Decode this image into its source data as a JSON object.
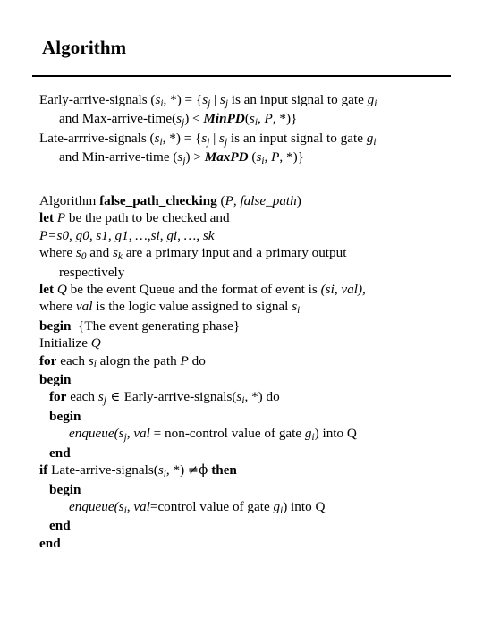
{
  "slide": {
    "title": "Algorithm",
    "definitions": [
      {
        "id": "early-arrive-signals",
        "line1_a": "Early-arrive-signals (",
        "line1_var1": "s",
        "line1_var1_sub": "i",
        "line1_b": ", *) = {",
        "line1_var2": "s",
        "line1_var2_sub": "j",
        "line1_c": " | ",
        "line1_var3": "s",
        "line1_var3_sub": "j",
        "line1_d": " is an input signal to gate ",
        "line1_var4": "g",
        "line1_var4_sub": "i",
        "line2_a": "and Max-arrive-time(",
        "line2_var1": "s",
        "line2_var1_sub": "j",
        "line2_b": ") < ",
        "line2_bold": "MinPD",
        "line2_c": "(",
        "line2_var2": "s",
        "line2_var2_sub": "i",
        "line2_d": ", ",
        "line2_var3": "P",
        "line2_e": ", *)}"
      },
      {
        "id": "late-arrive-signals",
        "line1_a": "Late-arrrive-signals (",
        "line1_var1": "s",
        "line1_var1_sub": "i",
        "line1_b": ", *) = {",
        "line1_var2": "s",
        "line1_var2_sub": "j",
        "line1_c": " | ",
        "line1_var3": "s",
        "line1_var3_sub": "j",
        "line1_d": " is an input signal to gate ",
        "line1_var4": "g",
        "line1_var4_sub": "i",
        "line2_a": "and Min-arrive-time (",
        "line2_var1": "s",
        "line2_var1_sub": "j",
        "line2_b": ") > ",
        "line2_bold": "MaxPD",
        "line2_c": " (",
        "line2_var2": "s",
        "line2_var2_sub": "i",
        "line2_d": ", ",
        "line2_var3": "P",
        "line2_e": ", *)}"
      }
    ],
    "algorithm": {
      "header_keyword": "Algorithm",
      "header_name": "false_path_checking",
      "header_paren_open": " (",
      "header_param1": "P",
      "header_comma": ", ",
      "header_param2": "false_path",
      "header_paren_close": ")",
      "let_p_kw": "let",
      "let_p_var": "P",
      "let_p_text": " be the path to be checked and",
      "path_def": "P=s0, g0, s1, g1, …,si, gi, …, sk",
      "path_def_lhs": "P",
      "path_def_eq": "=",
      "path_def_seq": "s0, g0, s1, g1, …,si, gi, …, sk",
      "where_a": "where ",
      "where_var1": "s",
      "where_var1_sub": "0",
      "where_b": " and ",
      "where_var2": "s",
      "where_var2_sub": "k",
      "where_c": " are a primary input and a primary output",
      "where_cont": "respectively",
      "let_q_kw": "let",
      "let_q_var": "Q",
      "let_q_text": " be the event Queue and the format of event is ",
      "let_q_tuple": "(si, val),",
      "where_val_a": "where ",
      "where_val_it": "val",
      "where_val_b": " is the logic value assigned to signal ",
      "where_val_var": "s",
      "where_val_var_sub": "i",
      "begin_kw": "begin",
      "begin_comment": "{The event generating phase}",
      "initialize_text": "Initialize ",
      "initialize_var": "Q",
      "for_kw": "for",
      "for_a": " each ",
      "for_var": "s",
      "for_var_sub": "i",
      "for_b": " alogn the path ",
      "for_path": "P",
      "for_do": " do",
      "begin2_kw": "begin",
      "inner_for_kw": "for",
      "inner_for_a": " each ",
      "inner_for_var": "s",
      "inner_for_var_sub": "j",
      "inner_for_elem": " ∈ ",
      "inner_for_set": "Early-arrive-signals(",
      "inner_for_setvar": "s",
      "inner_for_setvar_sub": "i",
      "inner_for_setb": ", *)",
      "inner_for_do": " do",
      "begin3_kw": "begin",
      "enqueue1_name": "enqueue",
      "enqueue1_a": "(",
      "enqueue1_var": "s",
      "enqueue1_var_sub": "j",
      "enqueue1_b": ", ",
      "enqueue1_val": "val",
      "enqueue1_c": " = non-control value of gate ",
      "enqueue1_gate": "g",
      "enqueue1_gate_sub": "i",
      "enqueue1_d": ") into Q",
      "end1_kw": "end",
      "if_kw": "if",
      "if_a": " Late-arrive-signals(",
      "if_var": "s",
      "if_var_sub": "i",
      "if_b": ", *) ",
      "if_neq": "≠",
      "if_phi": "ϕ",
      "if_then": "then",
      "begin4_kw": "begin",
      "enqueue2_name": "enqueue",
      "enqueue2_a": "(",
      "enqueue2_var": "s",
      "enqueue2_var_sub": "i",
      "enqueue2_b": ", ",
      "enqueue2_val": "val",
      "enqueue2_c": "=control value of gate ",
      "enqueue2_gate": "g",
      "enqueue2_gate_sub": "i",
      "enqueue2_d": ") into Q",
      "end2_kw": "end",
      "end3_kw": "end"
    }
  }
}
